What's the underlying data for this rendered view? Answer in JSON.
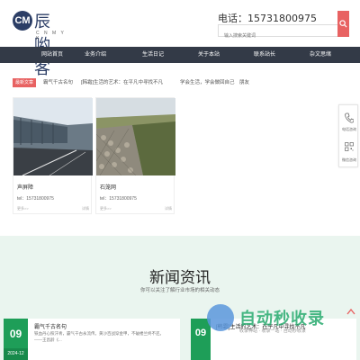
{
  "header": {
    "logo_mark": "CM",
    "logo_title": "辰哟客",
    "logo_sub": "C N M Y K",
    "phone": "电话：15731800975",
    "search_placeholder": "输入搜索关键词"
  },
  "nav": {
    "items": [
      {
        "label": "网站首页"
      },
      {
        "label": "业务介绍"
      },
      {
        "label": "生活日记"
      },
      {
        "label": "关于本站"
      },
      {
        "label": "联系站长"
      },
      {
        "label": "杂文思绪"
      }
    ]
  },
  "tags": {
    "head": "最新文章",
    "items": [
      {
        "label": "霸气千古名句"
      },
      {
        "label": "[韩霜]生活的艺术：在平凡中寻找不凡"
      },
      {
        "label": "学会生活，学会做回自己"
      },
      {
        "label": "朋友"
      }
    ]
  },
  "cards": [
    {
      "title": "声屏障",
      "tel": "tel：15731800975",
      "more": "更多>>",
      "views": "详情"
    },
    {
      "title": "石笼网",
      "tel": "tel：15731800975",
      "more": "更多>>",
      "views": "详情"
    }
  ],
  "side": {
    "phone_label": "电话咨询",
    "wechat_label": "微信咨询"
  },
  "news": {
    "title": "新闻资讯",
    "subtitle": "你可以关注了解行业市场的相关动态",
    "items": [
      {
        "day": "09",
        "ym": "2024-12",
        "title": "霸气千古名句",
        "text1": "铁血丹心照汗青，霸气千古永流传。黄沙百战穿金甲，不破楼兰终不还。",
        "text2": "——王昌龄《..."
      },
      {
        "day": "09",
        "title": "[韩霜]生活的艺术：在平凡中寻找不凡"
      }
    ]
  },
  "watermark": {
    "text": "自动秒收录",
    "small": "收录神站 · 收录一站 · 自动秒收录"
  },
  "colors": {
    "accent": "#e86262",
    "nav_bg": "#333a47",
    "green": "#1e9e58",
    "news_bg": "#eaf5ef"
  }
}
